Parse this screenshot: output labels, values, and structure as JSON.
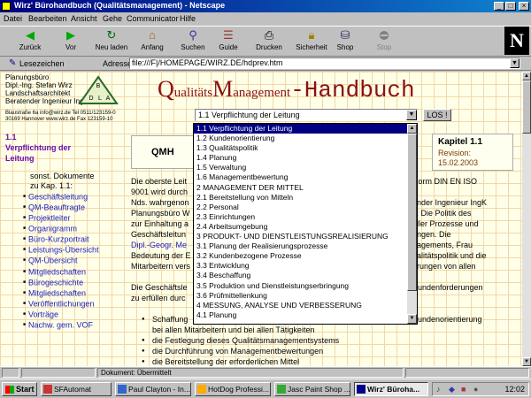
{
  "window": {
    "title": "Wirz' Bürohandbuch (Qualitätsmanagement) - Netscape"
  },
  "menu": [
    "Datei",
    "Bearbeiten",
    "Ansicht",
    "Gehe",
    "Communicator",
    "Hilfe"
  ],
  "toolbar": {
    "back": "Zurück",
    "forward": "Vor",
    "reload": "Neu laden",
    "home": "Anfang",
    "search": "Suchen",
    "guide": "Guide",
    "print": "Drucken",
    "security": "Sicherheit",
    "shop": "Shop",
    "stop": "Stop"
  },
  "location": {
    "bookmarks": "Lesezeichen",
    "address_label": "Adresse:",
    "url": "file:///F|/HOMEPAGE/WIRZ.DE/hdprev.htm"
  },
  "office": {
    "l1": "Planungsbüro",
    "l2": "Dipl.-Ing. Stefan Wirz",
    "l3": "Landschaftsarchitekt",
    "l4": "Beratender Ingenieur IngK Nds",
    "contact1": "Blaustraße 6a  info@wirz.de  Tel 0511/123159-0",
    "contact2": "30169 Hannover  www.wirz.de  Fax 123159-10",
    "logo_letters": [
      "B",
      "D",
      "L",
      "A"
    ]
  },
  "heading": {
    "q": "Q",
    "ualitats": "ualitäts",
    "m": "M",
    "anagement": "anagement",
    "handbuch": "-Handbuch"
  },
  "select": {
    "value": "1.1 Verpflichtung der Leitung",
    "button": "LOS !"
  },
  "dropdown_items": [
    "1.1 Verpflichtung der Leitung",
    "1.2 Kundenorientierung",
    "1.3 Qualitätspolitik",
    "1.4 Planung",
    "1.5 Verwaltung",
    "1.6 Managementbewertung",
    "2 MANAGEMENT DER MITTEL",
    "2.1 Bereitstellung von Mitteln",
    "2.2 Personal",
    "2.3 Einrichtungen",
    "2.4 Arbeitsumgebung",
    "3 PRODUKT- UND DIENSTLEISTUNGSREALISIERUNG",
    "3.1 Planung der Realisierungsprozesse",
    "3.2 Kundenbezogene Prozesse",
    "3.3 Entwicklung",
    "3.4 Beschaffung",
    "3.5 Produktion und Dienstleistungserbringung",
    "3.6 Prüfmittellenkung",
    "4 MESSUNG, ANALYSE UND VERBESSERUNG",
    "4.1 Planung"
  ],
  "sidebar": {
    "heading_l1": "1.1",
    "heading_l2": "Verpflichtung der",
    "heading_l3": "Leitung",
    "sonst_l1": "sonst. Dokumente",
    "sonst_l2": "zu Kap. 1.1:",
    "links": [
      "Geschäftsleitung",
      "QM-Beauftragte",
      "Projektleiter",
      "Organigramm",
      "Büro-Kurzportrait",
      "Leistungs-Übersicht",
      "QM-Übersicht",
      "Mitgliedschaften",
      "Bürogeschichte",
      "Mitgliedschaften",
      "Veröffentlichungen",
      "Vorträge",
      "Nachw. gem. VOF"
    ]
  },
  "doc": {
    "qmh": "QMH",
    "chapter_title_tail": "g",
    "kapitel": "Kapitel 1.1",
    "revision_label": "Revision:",
    "revision_date": "15.02.2003"
  },
  "body_left": [
    "Die oberste Leit",
    "9001 wird durch",
    "Nds. wahrgenon",
    "Planungsbüro W",
    "zur Einhaltung a",
    "Geschäftsleitun",
    "Dipl.-Geogr. Me",
    "Bedeutung der E",
    "Mitarbeitern vers",
    "Die Geschäftsle",
    "zu erfüllen durc"
  ],
  "body_right": [
    "Norm DIN EN ISO",
    "ender Ingenieur IngK",
    "z. Die Politik des",
    "aller Prozesse und",
    "ungen. Die",
    "nagements, Frau",
    "ualitätspolitik und die",
    "erungen von allen",
    "Kundenforderungen",
    "Kundenorientierung"
  ],
  "bullets": [
    "Schaffung",
    "bei allen Mitarbeitern und bei allen Tätigkeiten",
    "die Festlegung dieses Qualitätsmanagementsystems",
    "die Durchführung von Managementbewertungen",
    "die Bereitstellung der erforderlichen Mittel"
  ],
  "status": {
    "text": "Dokument: Übermittelt"
  },
  "taskbar": {
    "start": "Start",
    "tasks": [
      "SFAutomat",
      "Paul Clayton - In...",
      "HotDog Professi...",
      "Jasc Paint Shop ...",
      "Wirz' Büroha..."
    ],
    "clock": "12:02"
  },
  "colors": {
    "title_red": "#8b1010",
    "link_blue": "#2020c0",
    "sidebar_heading": "#6a0dad",
    "selection": "#000080",
    "page_bg": "#ffffe8"
  }
}
